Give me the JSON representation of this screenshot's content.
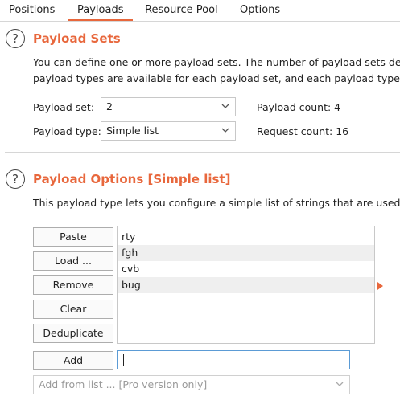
{
  "tabs": {
    "items": [
      "Positions",
      "Payloads",
      "Resource Pool",
      "Options"
    ],
    "active": "Payloads"
  },
  "payload_sets": {
    "title": "Payload Sets",
    "description_line1": "You can define one or more payload sets. The number of payload sets dep",
    "description_line2": "payload types are available for each payload set, and each payload type ca",
    "set_label": "Payload set:",
    "set_value": "2",
    "type_label": "Payload type:",
    "type_value": "Simple list",
    "count_label": "Payload count: 4",
    "request_label": "Request count: 16"
  },
  "payload_options": {
    "title": "Payload Options [Simple list]",
    "description": "This payload type lets you configure a simple list of strings that are used a",
    "buttons": {
      "paste": "Paste",
      "load": "Load ...",
      "remove": "Remove",
      "clear": "Clear",
      "deduplicate": "Deduplicate",
      "add": "Add"
    },
    "list_items": [
      "rty",
      "fgh",
      "cvb",
      "bug"
    ],
    "add_input_value": "",
    "add_from_list": "Add from list ... [Pro version only]"
  },
  "colors": {
    "accent": "#e8673c",
    "input_focus": "#5b9bd5"
  },
  "icons": [
    "help-icon",
    "chevron-down-icon",
    "selection-arrow-icon"
  ]
}
